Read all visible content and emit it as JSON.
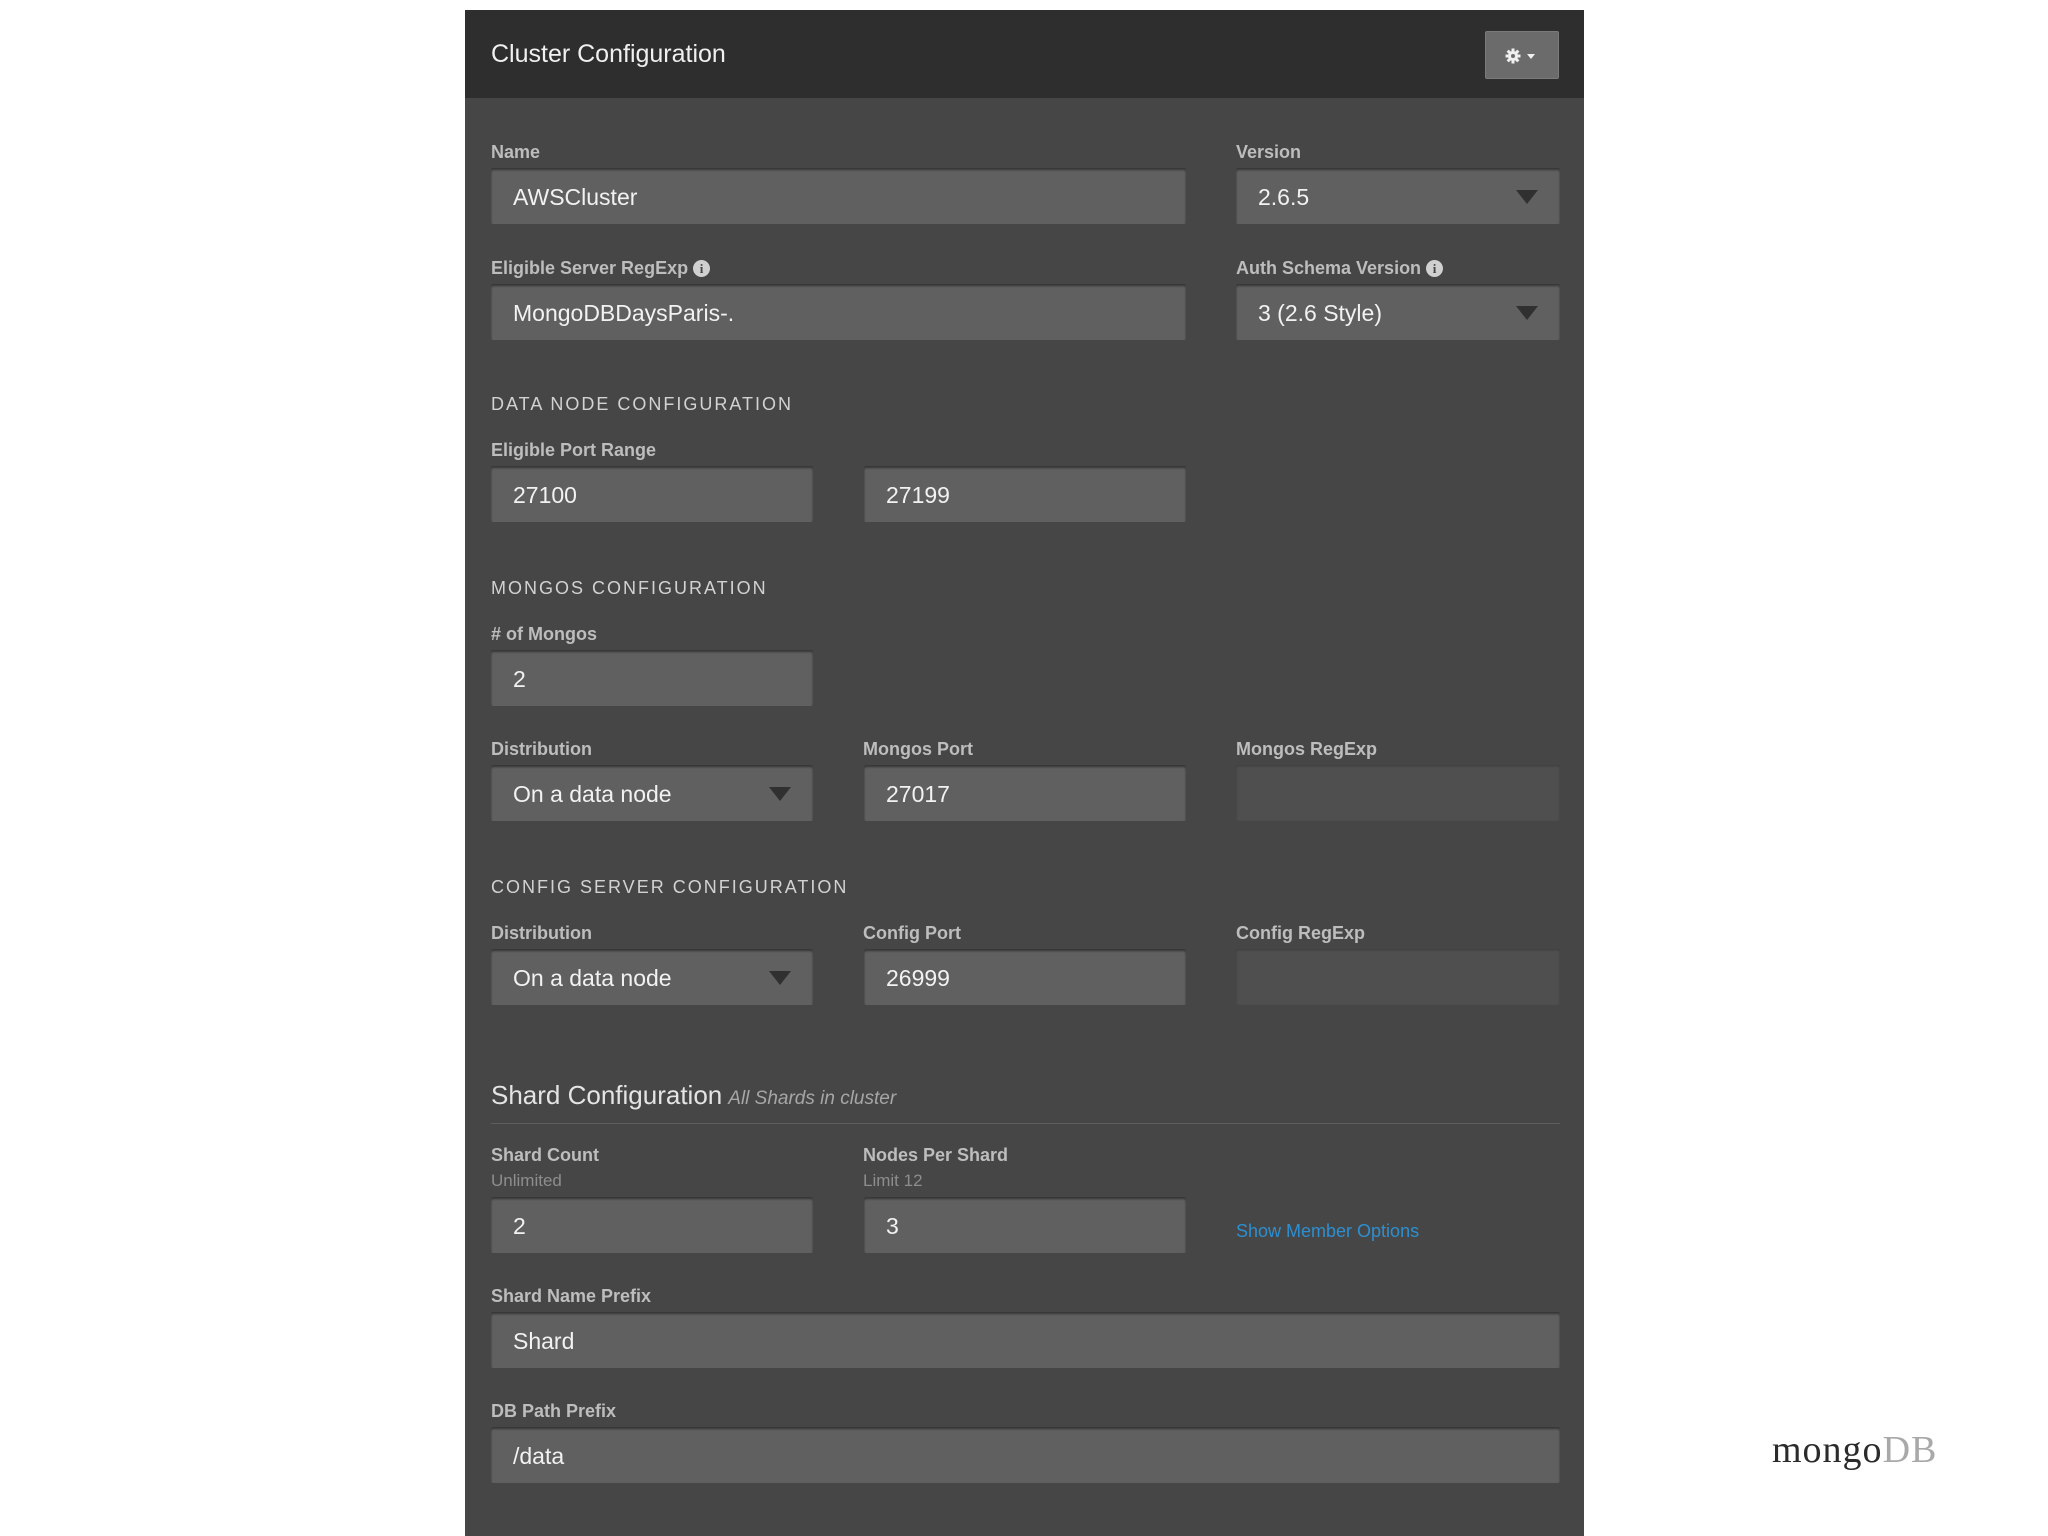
{
  "panel": {
    "title": "Cluster Configuration"
  },
  "header": {
    "settings_icon": "gear-icon",
    "dropdown_icon": "caret-down-icon"
  },
  "general": {
    "name": {
      "label": "Name",
      "value": "AWSCluster"
    },
    "version": {
      "label": "Version",
      "value": "2.6.5"
    },
    "eligible_server_regexp": {
      "label": "Eligible Server RegExp",
      "value": "MongoDBDaysParis-."
    },
    "auth_schema_version": {
      "label": "Auth Schema Version",
      "value": "3 (2.6 Style)"
    }
  },
  "data_node": {
    "heading": "DATA NODE CONFIGURATION",
    "port_range": {
      "label": "Eligible Port Range",
      "from": "27100",
      "to": "27199"
    }
  },
  "mongos": {
    "heading": "MONGOS CONFIGURATION",
    "count": {
      "label": "# of Mongos",
      "value": "2"
    },
    "distribution": {
      "label": "Distribution",
      "value": "On a data node"
    },
    "port": {
      "label": "Mongos Port",
      "value": "27017"
    },
    "regexp": {
      "label": "Mongos RegExp",
      "value": ""
    }
  },
  "config_server": {
    "heading": "CONFIG SERVER CONFIGURATION",
    "distribution": {
      "label": "Distribution",
      "value": "On a data node"
    },
    "port": {
      "label": "Config Port",
      "value": "26999"
    },
    "regexp": {
      "label": "Config RegExp",
      "value": ""
    }
  },
  "shard": {
    "title": "Shard Configuration",
    "subtitle": "All Shards in cluster",
    "count": {
      "label": "Shard Count",
      "hint": "Unlimited",
      "value": "2"
    },
    "nodes_per_shard": {
      "label": "Nodes Per Shard",
      "hint": "Limit 12",
      "value": "3"
    },
    "member_options_link": "Show Member Options",
    "name_prefix": {
      "label": "Shard Name Prefix",
      "value": "Shard"
    },
    "db_path_prefix": {
      "label": "DB Path Prefix",
      "value": "/data"
    }
  },
  "brand": {
    "part1": "mongo",
    "part2": "DB"
  },
  "colors": {
    "link": "#2d8fd0",
    "panel": "#464646",
    "header": "#2e2e2e"
  }
}
